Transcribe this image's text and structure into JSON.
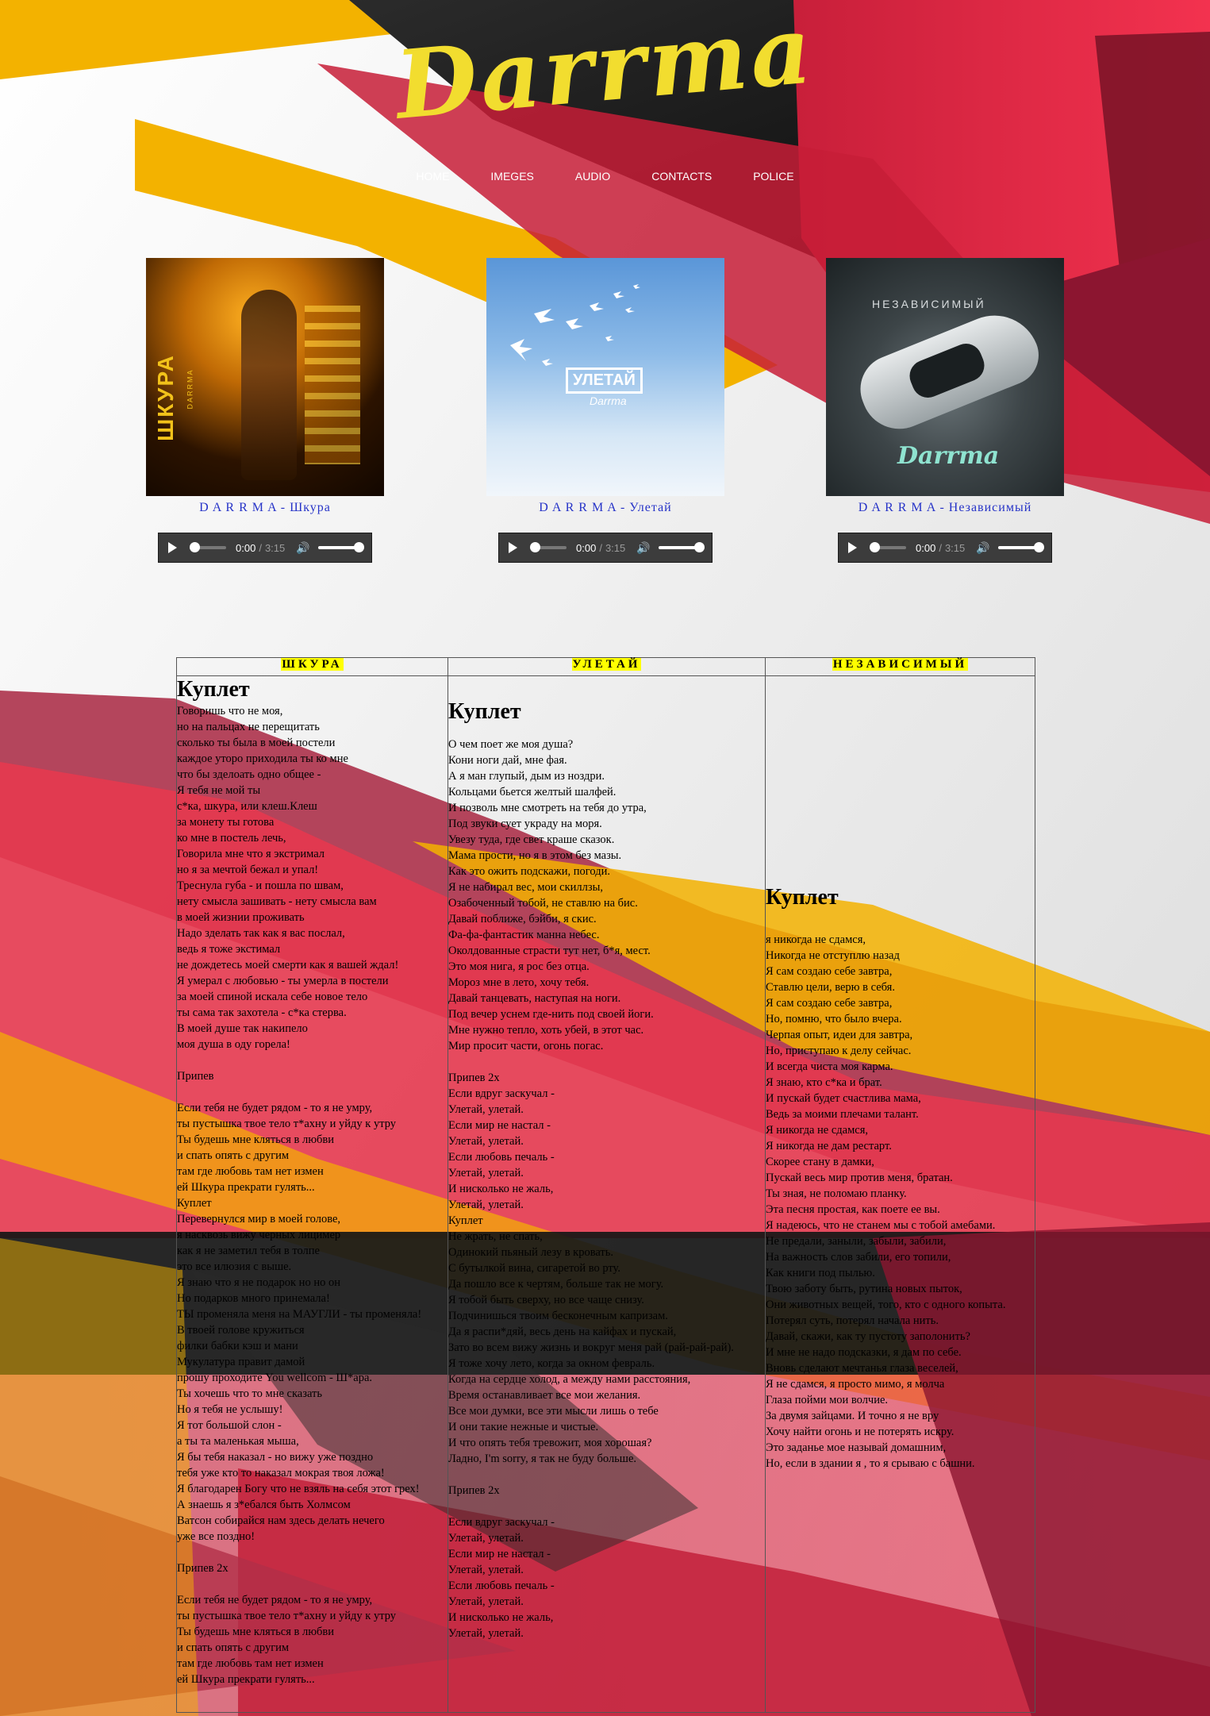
{
  "site": {
    "logo": "Darrma"
  },
  "nav": [
    "HOME",
    "IMEGES",
    "AUDIO",
    "CONTACTS",
    "POLICE"
  ],
  "albums": [
    {
      "cover_text": "ШКУРА",
      "cover_sub": "DARRMA",
      "track": "D A R R M A - Шкура",
      "player": {
        "current": "0:00",
        "separator": "/",
        "duration": "3:15"
      }
    },
    {
      "cover_text": "УЛЕТАЙ",
      "cover_sub": "Darrma",
      "track": "D A R R M A - Улетай",
      "player": {
        "current": "0:00",
        "separator": "/",
        "duration": "3:15"
      }
    },
    {
      "cover_text": "НЕЗАВИСИМЫЙ",
      "cover_sub": "Darrma",
      "track": "D A R R M A - Независимый",
      "player": {
        "current": "0:00",
        "separator": "/",
        "duration": "3:15"
      }
    }
  ],
  "lyrics": {
    "headers": [
      "ШКУРА",
      "УЛЕТАЙ",
      "НЕЗАВИСИМЫЙ"
    ],
    "verse_label": "Куплет",
    "columns": [
      "Говоришь что не моя,\nно на пальцах не перещитать\nсколько ты была в моей постели\nкаждое уторо приходила ты ко мне\nчто бы зделоать одно общее -\nЯ тебя не мой ты\nс*ка, шкура, или клеш.Клеш\nза монету ты готова\nко мне в постель лечь,\nГоворила мне что я экстримал\nно я за мечтой бежал и упал!\nТреснула губа - и пошла по швам,\nнету смысла зашивать - нету смысла вам\nв моей жизнии проживать\nНадо зделать так как я вас послал,\nведь я тоже экстимал\nне дождетесь моей смерти как я вашей ждал!\nЯ умерал с любовью - ты умерла в постели\nза моей спиной искала себе новое тело\nты сама так захотела - с*ка стерва.\nВ моей душе так накипело\nмоя душа в оду горела!\n\nПрипев\n\nЕсли тебя не будет рядом - то я не умру,\nты пустышка твое тело т*ахну и уйду к утру\nТы будешь мне кляться в любви\nи спать опять с другим\nтам где любовь там нет измен\nей Шкура прекрати гулять...\nКуплет\nПеревернулся мир в моей голове,\nя насквозь вижу черных лицимер\nкак я не заметил тебя в толпе\nэто все илюзия с выше.\nЯ знаю что я не подарок но но он\nНо подарков много принемала!\nТЫ променяла меня на МАУГЛИ - ты променяла!\nВ твоей голове кружиться\nфилки бабки кэш и мани\nМукулатура правит дамой\nпрошу проходите You wellcom - Ш*ара.\nТы хочешь что то мне сказать\nНо я тебя не услышу!\nЯ тот большой слон -\nа ты та маленькая мыша,\nЯ бы тебя наказал - но вижу уже поздно\nтебя уже кто то наказал мокрая твоя ложа!\nЯ благодарен Богу что не взяль на себя этот грех!\nА знаешь я з*ебался быть Холмсом\nВатсон собирайся нам здесь делать нечего\nуже все поздно!\n\nПрипев 2х\n\nЕсли тебя не будет рядом - то я не умру,\nты пустышка твое тело т*ахну и уйду к утру\nТы будешь мне кляться в любви\nи спать опять с другим\nтам где любовь там нет измен\nей Шкура прекрати гулять...",
      "О чем поет же моя душа?\nКони ноги дай, мне фая.\nА я ман глупый, дым из ноздри.\nКольцами бьется желтый шалфей.\nИ позволь мне смотреть на тебя до утра,\nПод звуки сует украду на моря.\nУвезу туда, где свет краше сказок.\nМама прости, но я в этом без мазы.\nКак это ожить подскажи, погоди.\nЯ не набирал вес, мои скиллзы,\nОзабоченный тобой, не ставлю на бис.\nДавай поближе, бэйби, я скис.\nФа-фа-фантастик манна небес.\nОколдованные страсти тут нет, б*я, мест.\nЭто моя нига, я рос без отца.\nМороз мне в лето, хочу тебя.\nДавай танцевать, наступая на ноги.\nПод вечер уснем где-нить под своей йоги.\nМне нужно тепло, хоть убей, в этот час.\nМир просит части, огонь погас.\n\nПрипев 2х\nЕсли вдруг заскучал -\nУлетай, улетай.\nЕсли мир не настал -\nУлетай, улетай.\nЕсли любовь печаль -\nУлетай, улетай.\nИ нисколько не жаль,\nУлетай, улетай.\nКуплет\nНе жрать, не спать,\nОдинокий пьяный лезу в кровать.\nС бутылкой вина, сигаретой во рту.\nДа пошло все к чертям, больше так не могу.\nЯ тобой быть сверху, но все чаще снизу.\nПодчинишься твоим бесконечным капризам.\nДа я распи*дяй, весь день на кайфах и пускай,\nЗато во всем вижу жизнь и вокруг меня рай (рай-рай-рай).\nЯ тоже хочу лето, когда за окном февраль.\nКогда на сердце холод, а между нами расстояния,\nВремя останавливает все мои желания.\nВсе мои думки, все эти мысли лишь о тебе\nИ они такие нежные и чистые.\nИ что опять тебя тревожит, моя хорошая?\nЛадно, I'm sorry, я так не буду больше.\n\nПрипев 2х\n\nЕсли вдруг заскучал -\nУлетай, улетай.\nЕсли мир не настал -\nУлетай, улетай.\nЕсли любовь печаль -\nУлетай, улетай.\nИ нисколько не жаль,\nУлетай, улетай.",
      "я никогда не сдамся,\nНикогда не отступлю назад\nЯ сам создаю себе завтра,\nСтавлю цели, верю в себя.\nЯ сам создаю себе завтра,\nНо, помню, что было вчера.\nЧерпая опыт, идеи для завтра,\nНо, приступаю к делу сейчас.\nИ всегда чиста моя карма.\nЯ знаю, кто с*ка и брат.\nИ пускай будет счастлива мама,\nВедь за моими плечами талант.\nЯ никогда не сдамся,\nЯ никогда не дам рестарт.\nСкорее стану в дамки,\nПускай весь мир против меня, братан.\nТы зная, не поломаю планку.\nЭта песня простая, как поете ее вы.\nЯ надеюсь, что не станем мы с тобой амебами.\nНе предали, заныли, забыли, забили,\nНа важность слов забили, его топили,\nКак книги под пылью.\nТвою заботу быть, рутина новых пыток,\nОни животных вещей, того, кто с одного копыта.\nПотерял суть, потерял начала нить.\nДавай, скажи, как ту пустоту заполонить?\nИ мне не надо подсказки, я дам по себе.\nВновь сделают мечтанья глаза веселей,\nЯ не сдамся, я просто мимо, я молча\nГлаза пойми мои волчие.\nЗа двумя зайцами. И точно я не вру\nХочу найти огонь и не потерять искру.\nЭто заданье мое называй домашним,\nНо, если в здании я , то я срываю с башни."
    ]
  },
  "colors": {
    "logo": "#f2dd2f",
    "link": "#2633c8",
    "highlight": "#ffff00",
    "red": "#e8314a",
    "yellow": "#f3b200",
    "dark": "#1b1b1b"
  }
}
